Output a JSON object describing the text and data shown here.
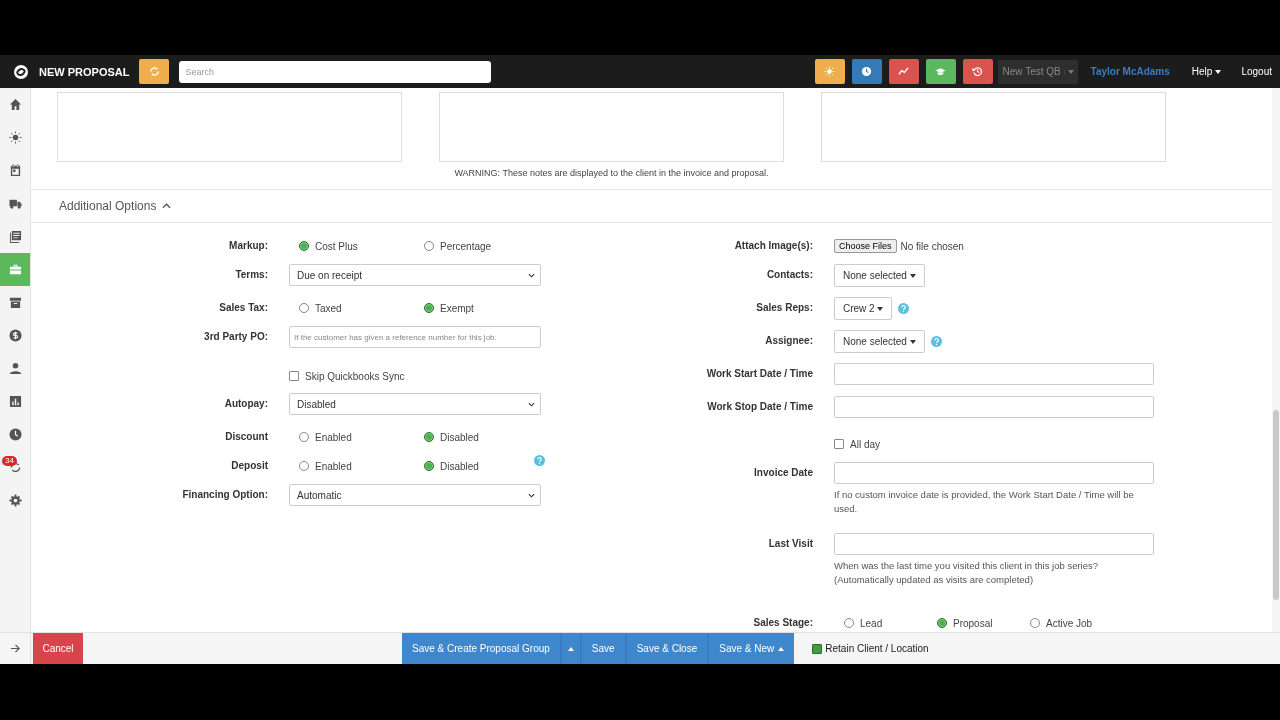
{
  "header": {
    "title": "NEW PROPOSAL",
    "search": {
      "placeholder": "Search"
    },
    "tools": [
      {
        "color": "#f0ad4e"
      },
      {
        "color": "#337ab7"
      },
      {
        "color": "#d9534f"
      },
      {
        "color": "#5cb85c"
      },
      {
        "color": "#d9534f"
      }
    ],
    "account": "New Test QB",
    "user": "Taylor McAdams",
    "help": "Help",
    "logout": "Logout"
  },
  "sidebar": {
    "items": [
      {
        "selected": false
      },
      {
        "selected": false
      },
      {
        "selected": false
      },
      {
        "selected": false
      },
      {
        "selected": false
      },
      {
        "selected": true
      },
      {
        "selected": false
      },
      {
        "selected": false
      },
      {
        "selected": false
      },
      {
        "selected": false
      },
      {
        "selected": false
      },
      {
        "selected": false,
        "badge": "34"
      },
      {
        "selected": false
      }
    ]
  },
  "notes": {
    "warning": "WARNING: These notes are displayed to the client in the invoice and proposal."
  },
  "section": {
    "title": "Additional Options",
    "expanded": true
  },
  "left_fields": [
    {
      "kind": "radio",
      "label": "Markup:",
      "options": [
        {
          "label": "Cost Plus",
          "selected": true
        },
        {
          "label": "Percentage",
          "selected": false
        }
      ]
    },
    {
      "kind": "select",
      "label": "Terms:",
      "value": "Due on receipt"
    },
    {
      "kind": "radio",
      "label": "Sales Tax:",
      "options": [
        {
          "label": "Taxed",
          "selected": false
        },
        {
          "label": "Exempt",
          "selected": true
        }
      ]
    },
    {
      "kind": "text",
      "label": "3rd Party PO:",
      "placeholder": "If the customer has given a reference number for this job."
    },
    {
      "kind": "checkbox",
      "label": "Skip Quickbooks Sync",
      "checked": false
    },
    {
      "kind": "select",
      "label": "Autopay:",
      "value": "Disabled"
    },
    {
      "kind": "radio",
      "label": "Discount",
      "options": [
        {
          "label": "Enabled",
          "selected": false
        },
        {
          "label": "Disabled",
          "selected": true
        }
      ]
    },
    {
      "kind": "radio",
      "label": "Deposit",
      "options": [
        {
          "label": "Enabled",
          "selected": false
        },
        {
          "label": "Disabled",
          "selected": true
        }
      ],
      "help": true
    },
    {
      "kind": "select",
      "label": "Financing Option:",
      "value": "Automatic"
    }
  ],
  "right_fields": [
    {
      "kind": "file",
      "label": "Attach Image(s):",
      "button": "Choose Files",
      "status": "No file chosen"
    },
    {
      "kind": "dropdown",
      "label": "Contacts:",
      "value": "None selected"
    },
    {
      "kind": "dropdown",
      "label": "Sales Reps:",
      "value": "Crew 2",
      "help": true
    },
    {
      "kind": "dropdown",
      "label": "Assignee:",
      "value": "None selected",
      "help": true
    },
    {
      "kind": "text",
      "label": "Work Start Date / Time"
    },
    {
      "kind": "text",
      "label": "Work Stop Date / Time"
    },
    {
      "kind": "checkbox",
      "label": "All day",
      "checked": false
    },
    {
      "kind": "text",
      "label": "Invoice Date",
      "note": "If no custom invoice date is provided, the Work Start Date / Time will be used."
    },
    {
      "kind": "text",
      "label": "Last Visit",
      "note": "When was the last time you visited this client in this job series? (Automatically updated as visits are completed)"
    },
    {
      "kind": "radio",
      "label": "Sales Stage:",
      "options": [
        {
          "label": "Lead",
          "selected": false
        },
        {
          "label": "Proposal",
          "selected": true
        },
        {
          "label": "Active Job",
          "selected": false
        }
      ]
    }
  ],
  "footer": {
    "cancel": "Cancel",
    "buttons": [
      {
        "kind": "button",
        "label": "Save & Create Proposal Group"
      },
      {
        "kind": "menu"
      },
      {
        "kind": "button",
        "label": "Save"
      },
      {
        "kind": "button",
        "label": "Save & Close"
      },
      {
        "kind": "dropup",
        "label": "Save & New"
      }
    ],
    "retain": {
      "label": "Retain Client / Location",
      "checked": true
    }
  }
}
